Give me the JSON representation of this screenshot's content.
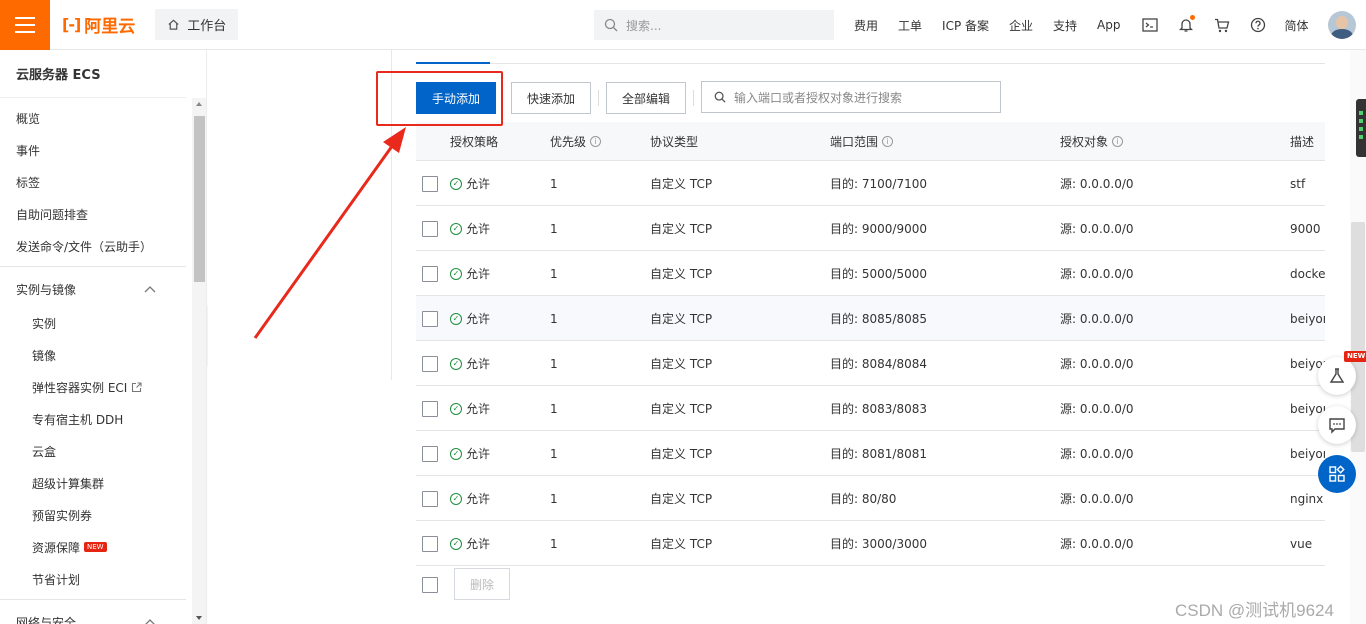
{
  "header": {
    "logo_text": "阿里云",
    "logo_mark": "[-]",
    "workbench": "工作台",
    "search_placeholder": "搜索...",
    "nav": [
      "费用",
      "工单",
      "ICP 备案",
      "企业",
      "支持",
      "App"
    ],
    "language": "简体"
  },
  "sidebar": {
    "title": "云服务器 ECS",
    "top_items": [
      "概览",
      "事件",
      "标签",
      "自助问题排查",
      "发送命令/文件（云助手）"
    ],
    "group1": "实例与镜像",
    "group1_items": [
      "实例",
      "镜像",
      "弹性容器实例 ECI",
      "专有宿主机 DDH",
      "云盒",
      "超级计算集群",
      "预留实例券",
      "资源保障",
      "节省计划"
    ],
    "new_badge": "NEW",
    "group2": "网络与安全"
  },
  "toolbar": {
    "manual_add": "手动添加",
    "quick_add": "快速添加",
    "edit_all": "全部编辑",
    "filter_placeholder": "输入端口或者授权对象进行搜索"
  },
  "table": {
    "headers": {
      "policy": "授权策略",
      "priority": "优先级",
      "protocol": "协议类型",
      "port": "端口范围",
      "source": "授权对象",
      "desc": "描述"
    },
    "rows": [
      {
        "policy": "允许",
        "priority": "1",
        "protocol": "自定义 TCP",
        "port": "目的: 7100/7100",
        "source": "源: 0.0.0.0/0",
        "desc": "stf"
      },
      {
        "policy": "允许",
        "priority": "1",
        "protocol": "自定义 TCP",
        "port": "目的: 9000/9000",
        "source": "源: 0.0.0.0/0",
        "desc": "9000"
      },
      {
        "policy": "允许",
        "priority": "1",
        "protocol": "自定义 TCP",
        "port": "目的: 5000/5000",
        "source": "源: 0.0.0.0/0",
        "desc": "docker"
      },
      {
        "policy": "允许",
        "priority": "1",
        "protocol": "自定义 TCP",
        "port": "目的: 8085/8085",
        "source": "源: 0.0.0.0/0",
        "desc": "beiyon"
      },
      {
        "policy": "允许",
        "priority": "1",
        "protocol": "自定义 TCP",
        "port": "目的: 8084/8084",
        "source": "源: 0.0.0.0/0",
        "desc": "beiyon"
      },
      {
        "policy": "允许",
        "priority": "1",
        "protocol": "自定义 TCP",
        "port": "目的: 8083/8083",
        "source": "源: 0.0.0.0/0",
        "desc": "beiyon"
      },
      {
        "policy": "允许",
        "priority": "1",
        "protocol": "自定义 TCP",
        "port": "目的: 8081/8081",
        "source": "源: 0.0.0.0/0",
        "desc": "beiyon"
      },
      {
        "policy": "允许",
        "priority": "1",
        "protocol": "自定义 TCP",
        "port": "目的: 80/80",
        "source": "源: 0.0.0.0/0",
        "desc": "nginx"
      },
      {
        "policy": "允许",
        "priority": "1",
        "protocol": "自定义 TCP",
        "port": "目的: 3000/3000",
        "source": "源: 0.0.0.0/0",
        "desc": "vue"
      }
    ],
    "hover_row": 3,
    "delete_label": "删除"
  },
  "floating": {
    "new_badge": "NEW"
  },
  "watermark": "CSDN @测试机9624",
  "colors": {
    "brand": "#ff6a00",
    "primary": "#0064c8",
    "annotation": "#e8291c",
    "allow": "#1e8e3e"
  }
}
